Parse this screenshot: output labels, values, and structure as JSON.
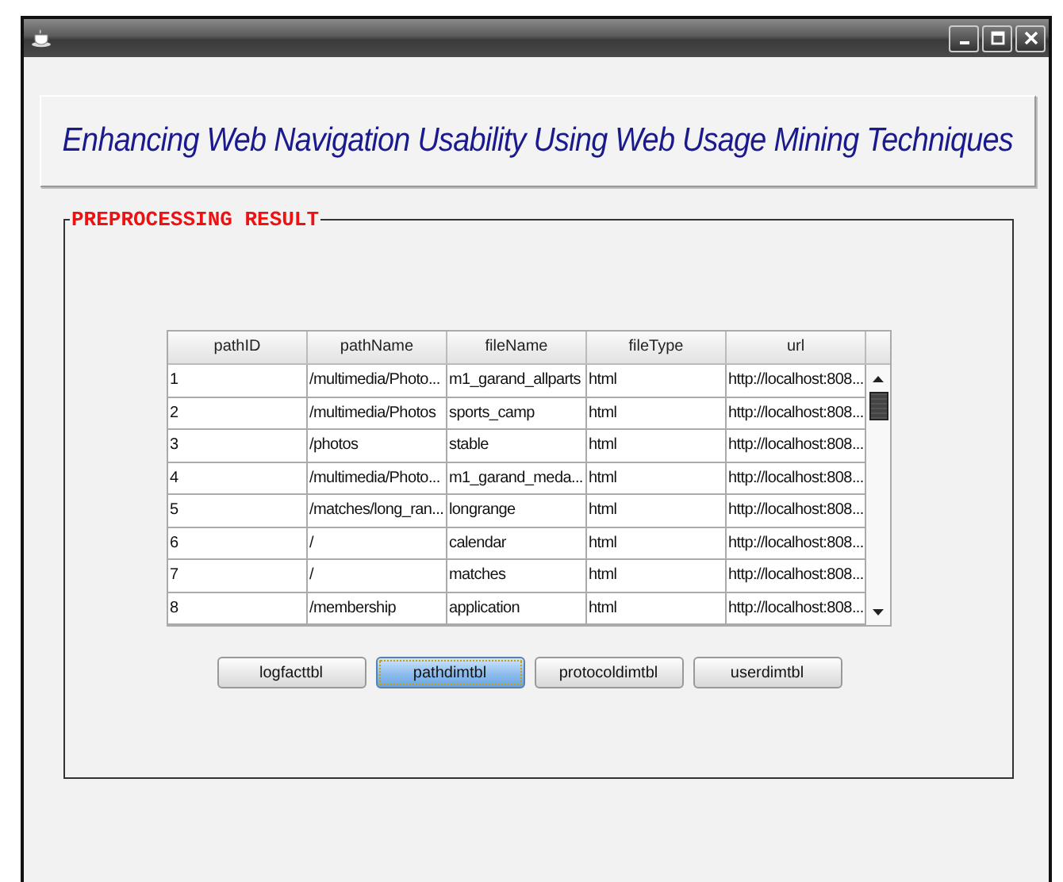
{
  "window": {
    "buttons": [
      {
        "kind": "minimize"
      },
      {
        "kind": "maximize"
      },
      {
        "kind": "close"
      }
    ]
  },
  "header": {
    "title": "Enhancing Web Navigation Usability Using Web Usage Mining Techniques"
  },
  "group": {
    "title": "PREPROCESSING RESULT"
  },
  "table": {
    "columns": [
      "pathID",
      "pathName",
      "fileName",
      "fileType",
      "url"
    ],
    "rows": [
      [
        "1",
        "/multimedia/Photo...",
        "m1_garand_allparts",
        "html",
        "http://localhost:808..."
      ],
      [
        "2",
        "/multimedia/Photos",
        "sports_camp",
        "html",
        "http://localhost:808..."
      ],
      [
        "3",
        "/photos",
        "stable",
        "html",
        "http://localhost:808..."
      ],
      [
        "4",
        "/multimedia/Photo...",
        "m1_garand_meda...",
        "html",
        "http://localhost:808..."
      ],
      [
        "5",
        "/matches/long_ran...",
        "longrange",
        "html",
        "http://localhost:808..."
      ],
      [
        "6",
        "/",
        "calendar",
        "html",
        "http://localhost:808..."
      ],
      [
        "7",
        "/",
        "matches",
        "html",
        "http://localhost:808..."
      ],
      [
        "8",
        "/membership",
        "application",
        "html",
        "http://localhost:808..."
      ]
    ]
  },
  "buttons": [
    {
      "label": "logfacttbl",
      "selected": false
    },
    {
      "label": "pathdimtbl",
      "selected": true
    },
    {
      "label": "protocoldimtbl",
      "selected": false
    },
    {
      "label": "userdimtbl",
      "selected": false
    }
  ]
}
